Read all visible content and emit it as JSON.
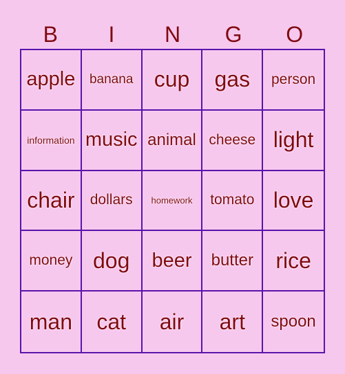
{
  "header": [
    "B",
    "I",
    "N",
    "G",
    "O"
  ],
  "cells": [
    "apple",
    "banana",
    "cup",
    "gas",
    "person",
    "information",
    "music",
    "animal",
    "cheese",
    "light",
    "chair",
    "dollars",
    "homework",
    "tomato",
    "love",
    "money",
    "dog",
    "beer",
    "butter",
    "rice",
    "man",
    "cat",
    "air",
    "art",
    "spoon"
  ],
  "colors": {
    "background": "#f7c8ee",
    "text": "#7f0a10",
    "grid_border": "#5a14ab"
  }
}
